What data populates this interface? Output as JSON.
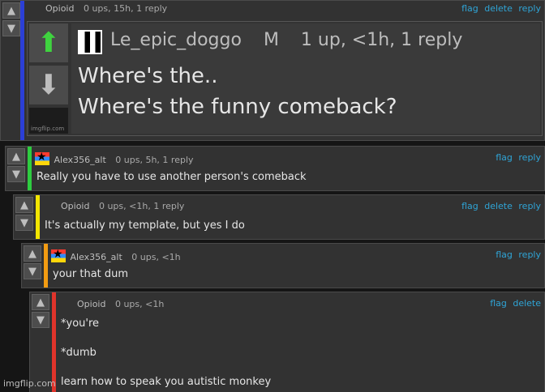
{
  "vote": {
    "up_icon": "up-arrow-icon",
    "down_icon": "down-arrow-icon"
  },
  "comments": [
    {
      "author": "Opioid",
      "meta": "0 ups, 15h, 1 reply",
      "actions": [
        "flag",
        "delete",
        "reply"
      ],
      "stripe_color": "#2b3fd6",
      "embed": {
        "name": "Le_epic_doggo",
        "badge": "M",
        "meta": "1 up, <1h, 1 reply",
        "line1": "Where's the..",
        "line2": "Where's the funny comeback?",
        "watermark": "imgflip.com"
      }
    },
    {
      "author": "Alex356_alt",
      "meta": "0 ups, 5h, 1 reply",
      "actions": [
        "flag",
        "reply"
      ],
      "stripe_color": "#2ecc40",
      "text": "Really you have to use another person's comeback"
    },
    {
      "author": "Opioid",
      "meta": "0 ups, <1h, 1 reply",
      "actions": [
        "flag",
        "delete",
        "reply"
      ],
      "stripe_color": "#f3e600",
      "text": "It's actually my template, but yes I do"
    },
    {
      "author": "Alex356_alt",
      "meta": "0 ups, <1h",
      "actions": [
        "flag",
        "reply"
      ],
      "stripe_color": "#f39c12",
      "text": "your that dum"
    },
    {
      "author": "Opioid",
      "meta": "0 ups, <1h",
      "actions": [
        "flag",
        "delete"
      ],
      "stripe_color": "#e0342b",
      "lines": [
        "*you're",
        "*dumb",
        "learn how to speak you autistic monkey"
      ]
    }
  ],
  "watermark": "imgflip.com"
}
